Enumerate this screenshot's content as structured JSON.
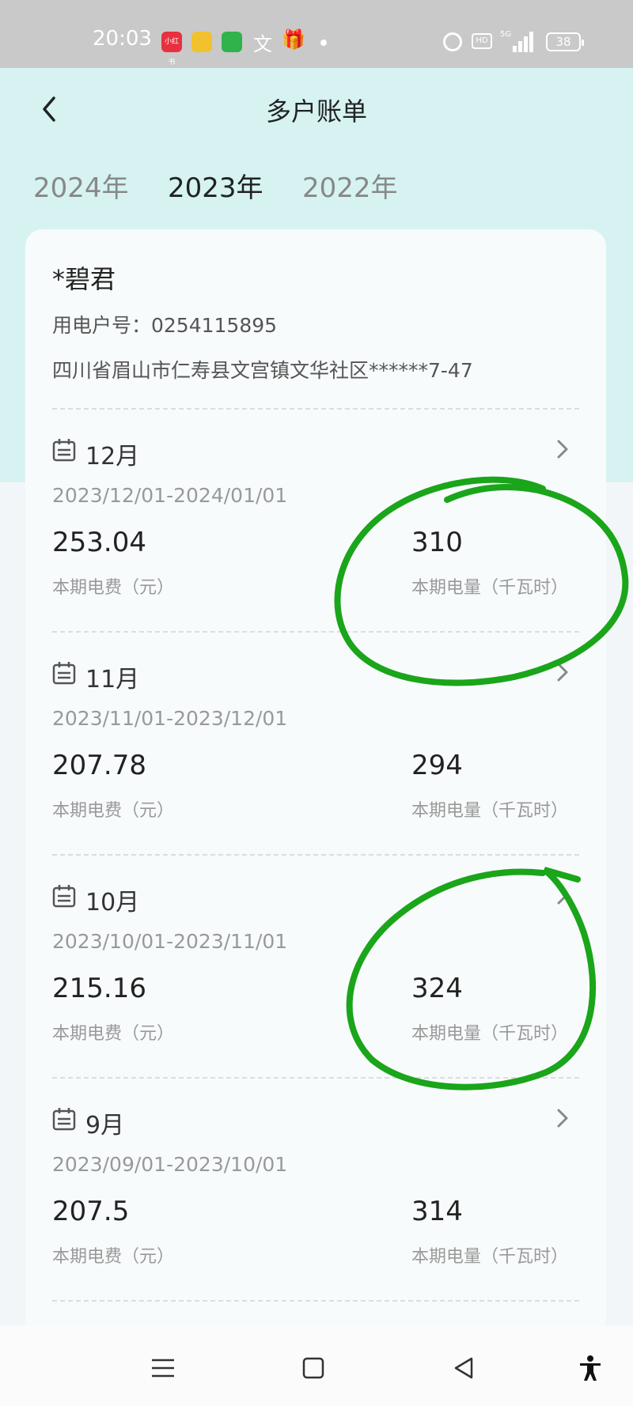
{
  "status_bar": {
    "time": "20:03",
    "apps": [
      {
        "name": "xiaohongshu-icon",
        "label": "小红书",
        "color": "#e8303f"
      },
      {
        "name": "notes-app-icon",
        "label": "",
        "color": "#f2c12e"
      },
      {
        "name": "messages-app-icon",
        "label": "",
        "color": "#2fb34a"
      }
    ],
    "hd_label": "HD",
    "network_label": "5G",
    "battery": "38"
  },
  "header": {
    "title": "多户账单",
    "back_icon": "chevron-left-icon"
  },
  "year_tabs": [
    {
      "label": "2024年",
      "active": false
    },
    {
      "label": "2023年",
      "active": true
    },
    {
      "label": "2022年",
      "active": false
    }
  ],
  "account": {
    "name": "*碧君",
    "number_line": "用电户号：0254115895",
    "address": "四川省眉山市仁寿县文宫镇文华社区******7-47"
  },
  "bills": [
    {
      "month": "12月",
      "period": "2023/12/01-2024/01/01",
      "fee": "253.04",
      "fee_label": "本期电费（元）",
      "kwh": "310",
      "kwh_label": "本期电量（千瓦时）"
    },
    {
      "month": "11月",
      "period": "2023/11/01-2023/12/01",
      "fee": "207.78",
      "fee_label": "本期电费（元）",
      "kwh": "294",
      "kwh_label": "本期电量（千瓦时）"
    },
    {
      "month": "10月",
      "period": "2023/10/01-2023/11/01",
      "fee": "215.16",
      "fee_label": "本期电费（元）",
      "kwh": "324",
      "kwh_label": "本期电量（千瓦时）"
    },
    {
      "month": "9月",
      "period": "2023/09/01-2023/10/01",
      "fee": "207.5",
      "fee_label": "本期电费（元）",
      "kwh": "314",
      "kwh_label": "本期电量（千瓦时）"
    }
  ],
  "nav_bar": {
    "icons": [
      "menu-icon",
      "home-square-icon",
      "back-triangle-icon",
      "accessibility-icon"
    ]
  },
  "colors": {
    "header_bg": "#d6f3f2",
    "annotation": "#1aa51a",
    "status_bar_bg": "#c9c9c9"
  }
}
